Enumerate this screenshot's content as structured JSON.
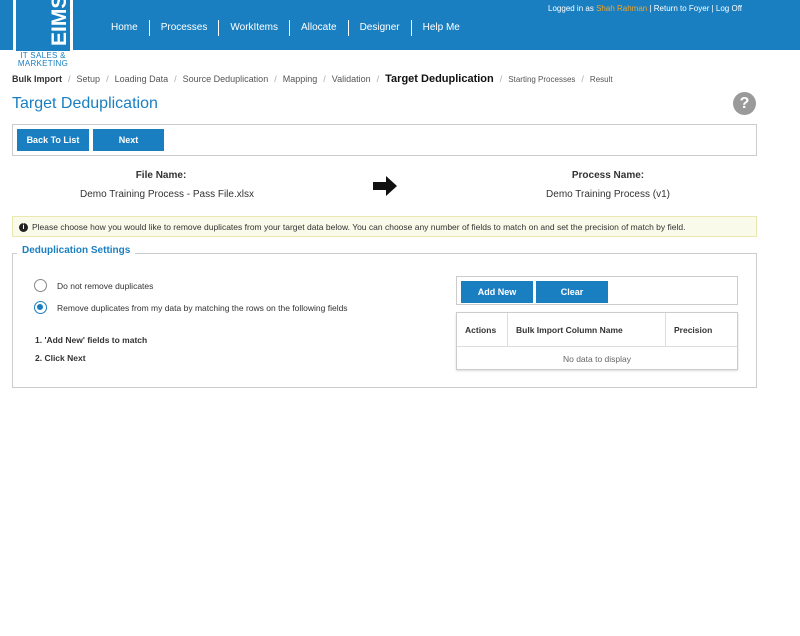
{
  "header": {
    "logo_text": "EIMS",
    "logo_sub_1": "IT SALES &",
    "logo_sub_2": "MARKETING",
    "nav": [
      "Home",
      "Processes",
      "WorkItems",
      "Allocate",
      "Designer",
      "Help Me"
    ],
    "logged_in_prefix": "Logged in as",
    "user_name": "Shah Rahman",
    "return_link": "Return to Foyer",
    "logoff_link": "Log Off",
    "link_separator": "|"
  },
  "breadcrumb": {
    "root": "Bulk Import",
    "steps": [
      "Setup",
      "Loading Data",
      "Source Deduplication",
      "Mapping",
      "Validation"
    ],
    "current": "Target Deduplication",
    "after": [
      "Starting Processes",
      "Result"
    ],
    "separator": "/"
  },
  "page": {
    "title": "Target Deduplication",
    "help_icon": "?"
  },
  "toolbar": {
    "back_label": "Back To List",
    "next_label": "Next"
  },
  "file": {
    "label": "File Name:",
    "value": "Demo Training Process - Pass File.xlsx"
  },
  "process": {
    "label": "Process Name:",
    "value": "Demo Training Process (v1)"
  },
  "notice": {
    "icon": "i",
    "text": "Please choose how you would like to remove duplicates from your target data below. You can choose any number of fields to match on and set the precision of match by field."
  },
  "settings": {
    "legend": "Deduplication Settings",
    "option_none": "Do not remove duplicates",
    "option_match": "Remove duplicates from my data by matching the rows on the following fields",
    "selected": "match",
    "step1": "1. 'Add New' fields to match",
    "step2": "2. Click Next",
    "add_new_label": "Add New",
    "clear_label": "Clear",
    "columns": [
      "Actions",
      "Bulk Import Column Name",
      "Precision"
    ],
    "empty_text": "No data to display"
  },
  "colors": {
    "brand": "#1a7fc1",
    "user_highlight": "#f7a21b",
    "notice_bg": "#fafaea"
  },
  "icons": {
    "arrow": "arrow-right-icon",
    "help": "help-icon",
    "info": "info-icon"
  }
}
